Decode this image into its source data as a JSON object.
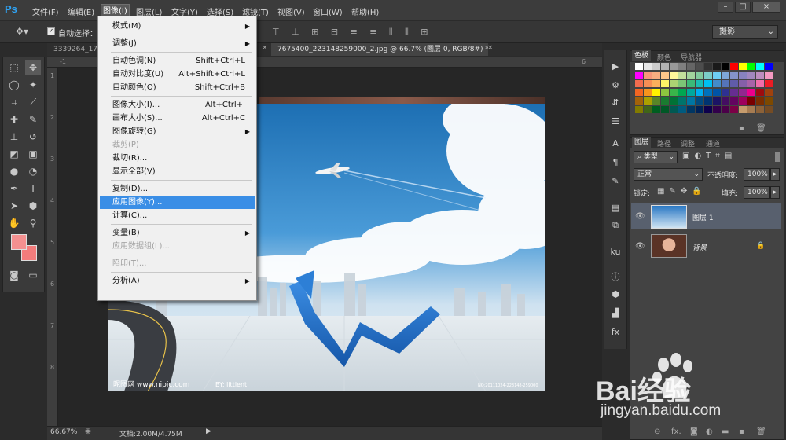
{
  "app": {
    "logo": "Ps",
    "menus": [
      "文件(F)",
      "编辑(E)",
      "图像(I)",
      "图层(L)",
      "文字(Y)",
      "选择(S)",
      "滤镜(T)",
      "视图(V)",
      "窗口(W)",
      "帮助(H)"
    ]
  },
  "window_controls": [
    "–",
    "□",
    "×"
  ],
  "options": {
    "auto_select_label": "自动选择：",
    "workspace": "摄影"
  },
  "tabs": [
    {
      "label": "3339264_17"
    },
    {
      "label": "7675400_223148259000_2.jpg @ 66.7% (图层 0, RGB/8#) *"
    }
  ],
  "rulers": {
    "h": [
      "-1",
      "6"
    ],
    "v": [
      "1",
      "2",
      "3",
      "4",
      "5",
      "6",
      "7",
      "8"
    ]
  },
  "image_menu": {
    "items": [
      {
        "label": "模式(M)",
        "shortcut": "",
        "submenu": true,
        "disabled": false
      },
      {
        "sep": true
      },
      {
        "label": "调整(J)",
        "shortcut": "",
        "submenu": true,
        "disabled": false
      },
      {
        "sep": true
      },
      {
        "label": "自动色调(N)",
        "shortcut": "Shift+Ctrl+L",
        "disabled": false
      },
      {
        "label": "自动对比度(U)",
        "shortcut": "Alt+Shift+Ctrl+L",
        "disabled": false
      },
      {
        "label": "自动颜色(O)",
        "shortcut": "Shift+Ctrl+B",
        "disabled": false
      },
      {
        "sep": true
      },
      {
        "label": "图像大小(I)...",
        "shortcut": "Alt+Ctrl+I",
        "disabled": false
      },
      {
        "label": "画布大小(S)...",
        "shortcut": "Alt+Ctrl+C",
        "disabled": false
      },
      {
        "label": "图像旋转(G)",
        "shortcut": "",
        "submenu": true,
        "disabled": false
      },
      {
        "label": "裁剪(P)",
        "shortcut": "",
        "disabled": true
      },
      {
        "label": "裁切(R)...",
        "shortcut": "",
        "disabled": false
      },
      {
        "label": "显示全部(V)",
        "shortcut": "",
        "disabled": false
      },
      {
        "sep": true
      },
      {
        "label": "复制(D)...",
        "shortcut": "",
        "disabled": false
      },
      {
        "label": "应用图像(Y)...",
        "shortcut": "",
        "disabled": false,
        "hover": true
      },
      {
        "label": "计算(C)...",
        "shortcut": "",
        "disabled": false
      },
      {
        "sep": true
      },
      {
        "label": "变量(B)",
        "shortcut": "",
        "submenu": true,
        "disabled": false
      },
      {
        "label": "应用数据组(L)...",
        "shortcut": "",
        "disabled": true
      },
      {
        "sep": true
      },
      {
        "label": "陷印(T)...",
        "shortcut": "",
        "disabled": true
      },
      {
        "sep": true
      },
      {
        "label": "分析(A)",
        "shortcut": "",
        "submenu": true,
        "disabled": false
      }
    ]
  },
  "swatches_panel": {
    "tabs": [
      "色板",
      "颜色",
      "导航器"
    ]
  },
  "layers_panel": {
    "tabs": [
      "图层",
      "路径",
      "调整",
      "通道"
    ],
    "filter": "类型",
    "blend_mode": "正常",
    "opacity_label": "不透明度:",
    "opacity": "100%",
    "lock_label": "锁定:",
    "fill_label": "填充:",
    "fill": "100%",
    "layers": [
      {
        "name": "图层 1",
        "selected": true
      },
      {
        "name": "背景",
        "selected": false
      }
    ]
  },
  "image_text": {
    "brand_left": "昵图网 www.nipic.com",
    "by": "BY: littlent",
    "id": "NO:20111024-223148-259000"
  },
  "status": {
    "zoom": "66.67%",
    "doc": "文档:2.00M/4.75M"
  },
  "watermark": {
    "brand": "Bai经验",
    "url": "jingyan.baidu.com"
  },
  "colors": {
    "foreground": "#f49090",
    "background": "#f27c7c",
    "menu_highlight": "#3a8ee6",
    "ps_blue": "#2fa3f4"
  }
}
